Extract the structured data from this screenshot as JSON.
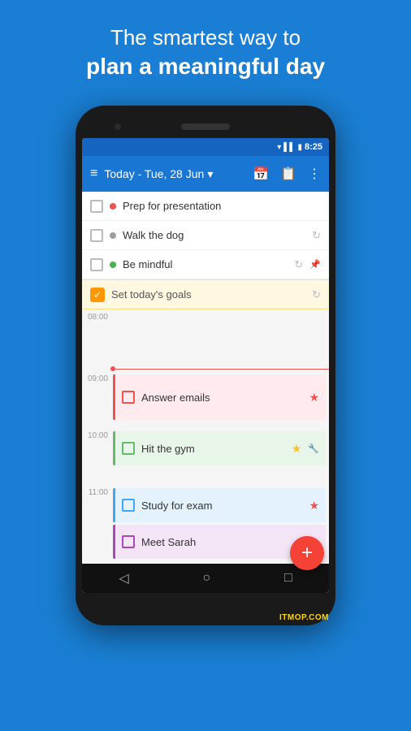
{
  "header": {
    "tagline1": "The smartest way to",
    "tagline2": "plan a meaningful day"
  },
  "statusBar": {
    "time": "8:25"
  },
  "toolbar": {
    "title": "Today - Tue, 28 Jun",
    "dropdownIcon": "▾"
  },
  "tasks": {
    "unscheduled": [
      {
        "id": 1,
        "text": "Prep for presentation",
        "dotColor": "#ef5350",
        "repeat": false,
        "pin": false
      },
      {
        "id": 2,
        "text": "Walk the dog",
        "dotColor": "#9e9e9e",
        "repeat": true,
        "pin": false
      },
      {
        "id": 3,
        "text": "Be mindful",
        "dotColor": "#4caf50",
        "repeat": true,
        "pin": true
      }
    ],
    "goals": {
      "text": "Set today's goals",
      "checked": true,
      "repeat": true
    },
    "timed": [
      {
        "time": "08:00",
        "tasks": []
      },
      {
        "time": "09:00",
        "label": "09:00",
        "task": {
          "text": "Answer emails",
          "color": "red",
          "star": true,
          "starColor": "red"
        }
      },
      {
        "time": "10:00",
        "label": "10:00",
        "task": {
          "text": "Hit the gym",
          "color": "green",
          "star": true,
          "starColor": "yellow",
          "pin": true
        }
      },
      {
        "time": "11:00",
        "label": "11:00",
        "tasks": [
          {
            "text": "Study for exam",
            "color": "blue",
            "star": true,
            "starColor": "red"
          },
          {
            "text": "Meet Sarah",
            "color": "purple"
          }
        ]
      }
    ]
  },
  "fab": {
    "label": "+"
  },
  "navigation": {
    "back": "◁",
    "home": "○",
    "recent": "□"
  },
  "watermark": "ITMOP.COM"
}
